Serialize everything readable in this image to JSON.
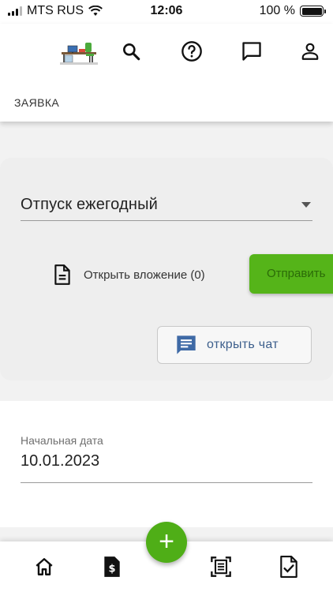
{
  "status_bar": {
    "carrier": "MTS RUS",
    "time": "12:06",
    "battery": "100 %"
  },
  "header": {
    "title": "ЗАЯВКА",
    "icons": [
      "logo-image",
      "search-icon",
      "help-icon",
      "chat-icon",
      "account-icon"
    ]
  },
  "request": {
    "type_value": "Отпуск ежегодный",
    "attachment_label": "Открыть вложение (0)",
    "send_label": "Отправить",
    "chat_label": "открыть чат"
  },
  "dates": {
    "start_label": "Начальная дата",
    "start_value": "10.01.2023"
  },
  "bottom_nav": {
    "items": [
      "home-icon",
      "payroll-icon",
      "documents-icon",
      "approvals-icon"
    ],
    "fab_label": "+"
  },
  "colors": {
    "accent_green": "#55b419",
    "chat_text": "#3d5f8c",
    "chat_icon": "#3f6aa6"
  }
}
